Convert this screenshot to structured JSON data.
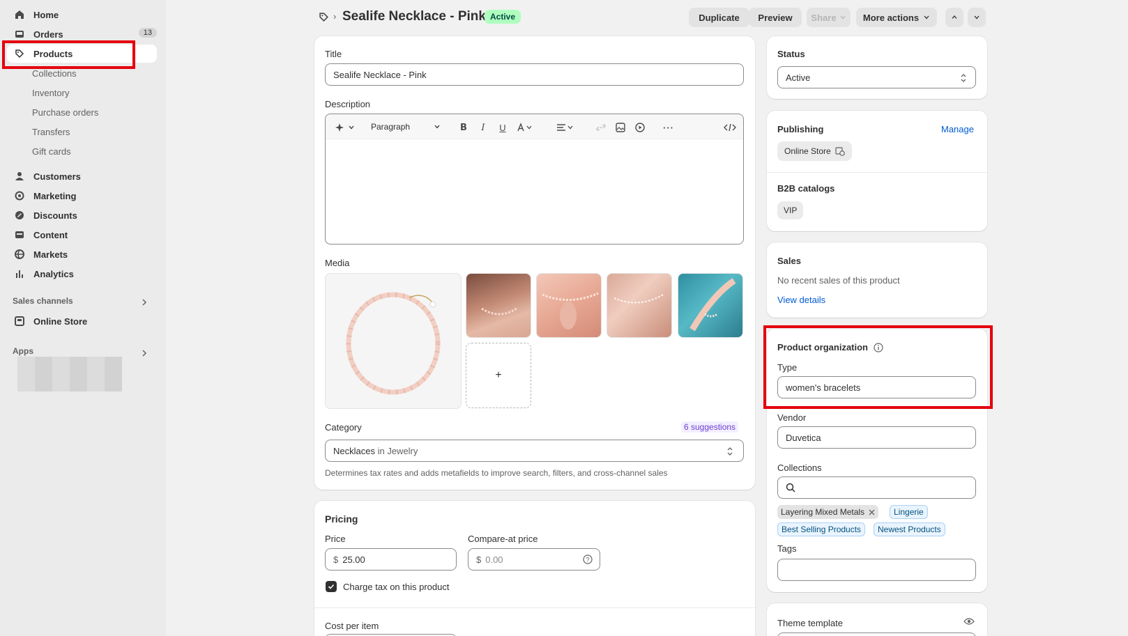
{
  "nav": {
    "home": "Home",
    "orders": "Orders",
    "orders_badge": "13",
    "products": "Products",
    "collections": "Collections",
    "inventory": "Inventory",
    "purchase_orders": "Purchase orders",
    "transfers": "Transfers",
    "gift_cards": "Gift cards",
    "customers": "Customers",
    "marketing": "Marketing",
    "discounts": "Discounts",
    "content": "Content",
    "markets": "Markets",
    "analytics": "Analytics",
    "sales_channels": "Sales channels",
    "online_store": "Online Store",
    "apps": "Apps"
  },
  "header": {
    "breadcrumb_sep": "›",
    "product_title": "Sealife Necklace - Pink",
    "status_badge": "Active",
    "duplicate": "Duplicate",
    "preview": "Preview",
    "share": "Share",
    "more_actions": "More actions"
  },
  "product": {
    "title_label": "Title",
    "title_value": "Sealife Necklace - Pink",
    "description_label": "Description",
    "paragraph": "Paragraph",
    "media_label": "Media",
    "add_media": "+",
    "category_label": "Category",
    "suggestions": "6 suggestions",
    "category_value": "Necklaces",
    "category_in": "in Jewelry",
    "category_help": "Determines tax rates and adds metafields to improve search, filters, and cross-channel sales"
  },
  "pricing": {
    "heading": "Pricing",
    "price_label": "Price",
    "price_currency": "$",
    "price_value": "25.00",
    "compare_label": "Compare-at price",
    "compare_currency": "$",
    "compare_placeholder": "0.00",
    "charge_tax": "Charge tax on this product",
    "charge_tax_checked": true,
    "cost_label": "Cost per item"
  },
  "status": {
    "heading": "Status",
    "value": "Active"
  },
  "publishing": {
    "heading": "Publishing",
    "manage": "Manage",
    "channel": "Online Store",
    "b2b_heading": "B2B catalogs",
    "b2b_value": "VIP"
  },
  "sales": {
    "heading": "Sales",
    "text": "No recent sales of this product",
    "link": "View details"
  },
  "organization": {
    "heading": "Product organization",
    "type_label": "Type",
    "type_value": "women's bracelets",
    "vendor_label": "Vendor",
    "vendor_value": "Duvetica",
    "collections_label": "Collections",
    "collection_tags": [
      "Layering Mixed Metals",
      "Lingerie",
      "Best Selling Products",
      "Newest Products"
    ],
    "tags_label": "Tags"
  },
  "theme": {
    "heading": "Theme template"
  },
  "colors": {
    "highlight": "#e5000f",
    "link": "#005bd3",
    "badge_green": "#affebf"
  }
}
